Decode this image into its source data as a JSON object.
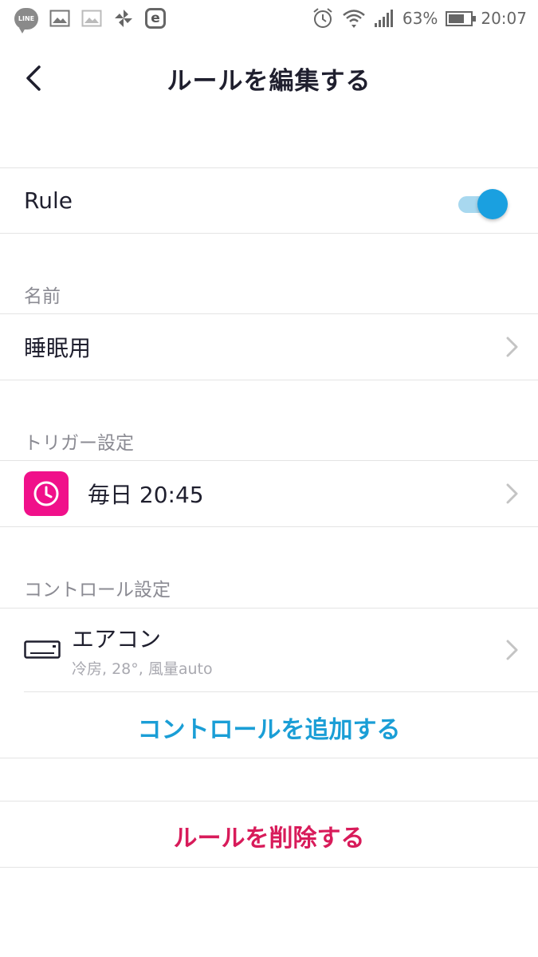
{
  "status_bar": {
    "left_icons": [
      "line-icon",
      "gallery-icon",
      "gallery-icon-faded",
      "pinwheel-icon",
      "e-app-icon"
    ],
    "line_label": "LINE",
    "e_label": "e",
    "battery_percent": "63%",
    "battery_level": 0.63,
    "time": "20:07"
  },
  "header": {
    "title": "ルールを編集する"
  },
  "rule_toggle": {
    "label": "Rule",
    "enabled": true
  },
  "name_section": {
    "label": "名前",
    "value": "睡眠用"
  },
  "trigger_section": {
    "label": "トリガー設定",
    "value": "毎日 20:45",
    "icon": "clock-icon",
    "icon_bg": "#f0108a"
  },
  "control_section": {
    "label": "コントロール設定",
    "device_name": "エアコン",
    "device_detail": "冷房, 28°, 風量auto",
    "device_icon": "air-conditioner-icon",
    "add_label": "コントロールを追加する"
  },
  "delete_label": "ルールを削除する",
  "colors": {
    "accent_blue": "#1a9ed6",
    "delete_red": "#d81b5a",
    "toggle_on": "#1aa0e0",
    "divider": "#e4e4e4",
    "section_text": "#8b8b93"
  }
}
